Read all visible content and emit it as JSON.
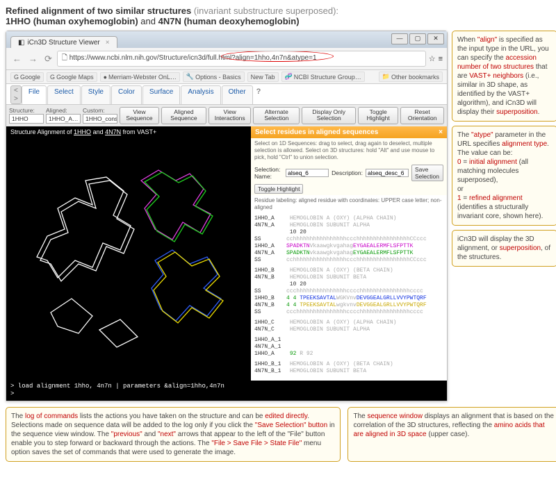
{
  "title": {
    "bold": "Refined alignment of two similar structures",
    "paren": "(invariant substructure superposed):",
    "line2a": "1HHO (human oxyhemoglobin)",
    "and": " and ",
    "line2b": "4N7N (human deoxyhemoglobin)"
  },
  "browser": {
    "tab_title": "iCn3D Structure Viewer",
    "url": "https://www.ncbi.nlm.nih.gov/Structure/icn3d/full.html?align=1hho,4n7n&atype=1",
    "url_star": "☆",
    "bookmarks": [
      "Google",
      "Google Maps",
      "Merriam-Webster OnL…",
      "Options - Basics",
      "New Tab",
      "NCBI Structure Group…"
    ],
    "other_bm": "Other bookmarks"
  },
  "menus": [
    "File",
    "Select",
    "Style",
    "Color",
    "Surface",
    "Analysis",
    "Other"
  ],
  "toolbar": {
    "structure_lbl": "Structure:",
    "structure_val": "1HHO",
    "aligned_lbl": "Aligned:",
    "aligned_val": "1HHO_A…",
    "custom_lbl": "Custom:",
    "custom_val": "1HHO_cons",
    "buttons": [
      "View\nSequence",
      "Aligned\nSequence",
      "View\nInteractions",
      "Alternate\nSelection",
      "Display Only\nSelection",
      "Toggle\nHighlight",
      "Reset\nOrientation"
    ]
  },
  "viewer_title_a": "Structure Alignment of ",
  "viewer_title_b": "1HHO",
  "viewer_title_c": " and ",
  "viewer_title_d": "4N7N",
  "viewer_title_e": " from VAST+",
  "panel2": {
    "header": "Select residues in aligned sequences",
    "close": "×",
    "instr": "Select on 1D Sequences: drag to select, drag again to deselect, multiple selection is allowed.\nSelect on 3D structures: hold \"Alt\" and use mouse to pick, hold \"Ctrl\" to union selection.",
    "sel_name_lbl": "Selection: Name:",
    "sel_name": "alseq_6",
    "sel_desc_lbl": "Description:",
    "sel_desc": "alseq_desc_6",
    "save_btn": "Save Selection",
    "toggle_btn": "Toggle Highlight",
    "residue_lbl": "Residue labeling: aligned residue with coordinates: UPPER case letter; non-aligned"
  },
  "seq": {
    "ruler": "                    10                    20",
    "blocks": [
      {
        "ch1": "1HHO_A",
        "ch2": "4N7N_A",
        "desc": "HEMOGLOBIN A (OXY) (ALPHA CHAIN)",
        "desc2": "HEMOGLOBIN SUBUNIT ALPHA",
        "l1": "cchhhhhhhhhhhhhhhhccchhhhhhhhhhhhhhhhCCccc",
        "s1_a": "SPADKTN",
        "s1_b": "Vkaawgkvgahag",
        "s1_c": "EYGAEALERMFLSFPTTK",
        "s2_a": "SPADKTN",
        "s2_b": "vkaawgkvgahag",
        "s2_c": "EYGAEALERMFLSFPTTK"
      },
      {
        "ch1": "1HHO_B",
        "ch2": "4N7N_B",
        "desc": "HEMOGLOBIN A (OXY) (BETA CHAIN)",
        "desc2": "HEMOGLOBIN SUBUNIT BETA",
        "l1": "ccchhhhhhhhhhhhhhhcccchhhhhhhhhhhhhhhcccc",
        "s1_a": "TPEEKSAVTAL",
        "s1_b": "WGKVnv",
        "s1_c": "DEVGGEALGRLLVVYPWTQRF",
        "s2_a": "TPEEKSAVTAL",
        "s2_b": "wgkvnv",
        "s2_c": "DEVGGEALGRLLVVYPWTQRF",
        "nums": "4           4"
      },
      {
        "ch1": "1HHO_C",
        "ch2": "4N7N_C",
        "desc": "HEMOGLOBIN A (OXY) (ALPHA CHAIN)",
        "desc2": "HEMOGLOBIN SUBUNIT ALPHA"
      },
      {
        "ch1": "1HHO_A_1",
        "ch2": "4N7N_A_1",
        "n1": "92",
        "r": "R  92",
        "desc": "",
        "desc2": ""
      },
      {
        "ch1": "1HHO_B_1",
        "ch2": "4N7N_B_1",
        "desc": "HEMOGLOBIN A (OXY) (BETA CHAIN)",
        "desc2": "HEMOGLOBIN SUBUNIT BETA"
      }
    ]
  },
  "cmdlog": [
    "> load alignment 1hho, 4n7n | parameters &align=1hho,4n7n",
    "> "
  ],
  "side": [
    {
      "html": "When <span class='redtxt'>\"align\"</span> is specified as the input type in the URL, you can specify the <span class='redtxt'>accession number of two structures</span> that are <span class='redtxt'>VAST+ neighbors</span> (i.e., similar in 3D shape, as identified by the VAST+ algorithm), and iCn3D will display their <span class='redtxt'>superposition</span>."
    },
    {
      "html": "The <span class='redtxt'>\"atype\"</span> parameter in the URL specifies <span class='redtxt'>alignment type</span>. The value can be:<br><span class='redtxt'>0</span> = <span class='redtxt'>initial alignment</span> (all matching molecules superposed),<br>or<br><span class='redtxt'>1</span> = <span class='redtxt'>refined alignment</span> (identifies a structurally invariant core, shown here)."
    },
    {
      "html": "iCn3D will display the 3D alignment, or <span class='redtxt'>superposition</span>, of the structures."
    }
  ],
  "bottom": [
    {
      "html": "The <span class='redtxt'>log of commands</span> lists the actions you have taken on the structure and can be <span class='redtxt'>edited directly</span>. Selections made on sequence data will be added to the log only if you click the <span class='redtxt'>\"Save Selection\" button</span> in the sequence view window. The <span class='redtxt'>\"previous\"</span> and <span class='redtxt'>\"next\"</span> arrows that appear to the left of the \"File\" button enable you to step forward or backward through the actions. The <span class='redtxt'>\"File &gt; Save File &gt; State File\"</span> menu option saves the set of commands that were used to generate the image."
    },
    {
      "html": "The <span class='redtxt'>sequence window</span> displays an alignment that is based on the correlation of the 3D structures, reflecting the <span class='redtxt'>amino acids that are aligned in 3D space</span> (upper case)."
    }
  ]
}
